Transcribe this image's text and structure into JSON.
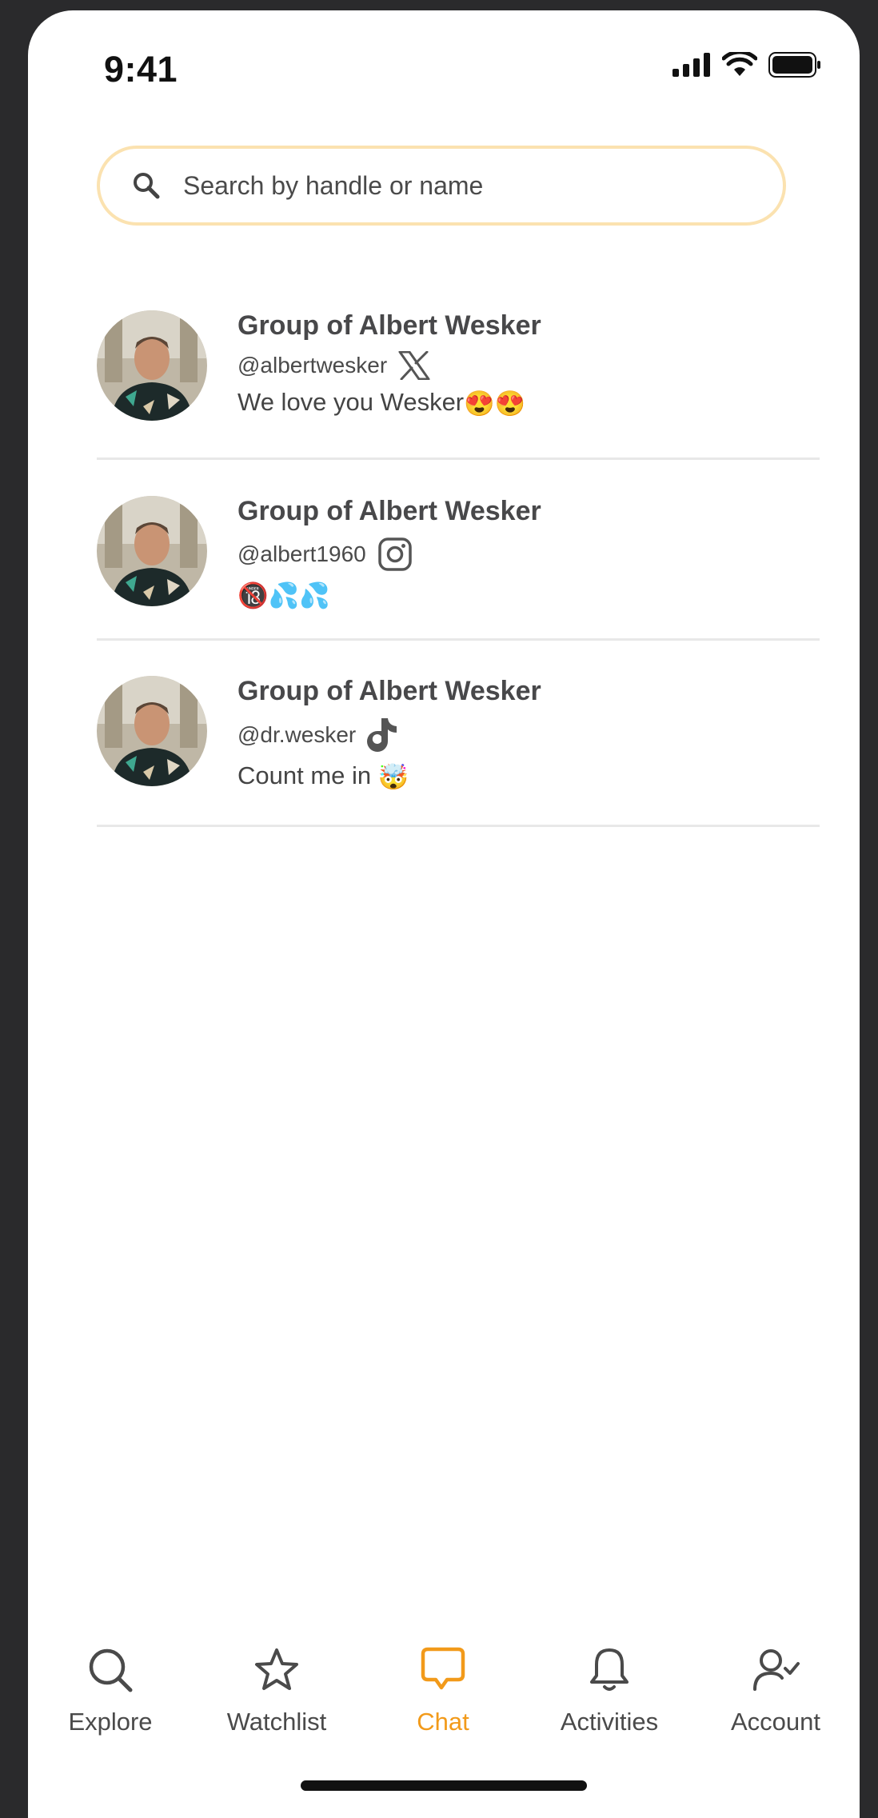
{
  "status_bar": {
    "time": "9:41"
  },
  "search": {
    "placeholder": "Search by handle or name",
    "value": ""
  },
  "chats": [
    {
      "title": "Group of Albert Wesker",
      "handle": "@albertwesker",
      "platform": "x-icon",
      "message": "We love you Wesker",
      "emojis": [
        "😍",
        "😍"
      ]
    },
    {
      "title": "Group of Albert Wesker",
      "handle": "@albert1960",
      "platform": "instagram-icon",
      "message": "",
      "emojis": [
        "🔞",
        "💦",
        "💦"
      ]
    },
    {
      "title": "Group of Albert Wesker",
      "handle": "@dr.wesker",
      "platform": "tiktok-icon",
      "message": "Count me in ",
      "emojis": [
        "🤯"
      ]
    }
  ],
  "tabs": [
    {
      "label": "Explore",
      "icon": "search-icon"
    },
    {
      "label": "Watchlist",
      "icon": "star-icon"
    },
    {
      "label": "Chat",
      "icon": "chat-bubble-icon",
      "active": true
    },
    {
      "label": "Activities",
      "icon": "bell-icon"
    },
    {
      "label": "Account",
      "icon": "user-check-icon"
    }
  ],
  "colors": {
    "accent": "#f29a1a",
    "search_border": "#fbe2b0",
    "divider": "#e8e8e8"
  }
}
